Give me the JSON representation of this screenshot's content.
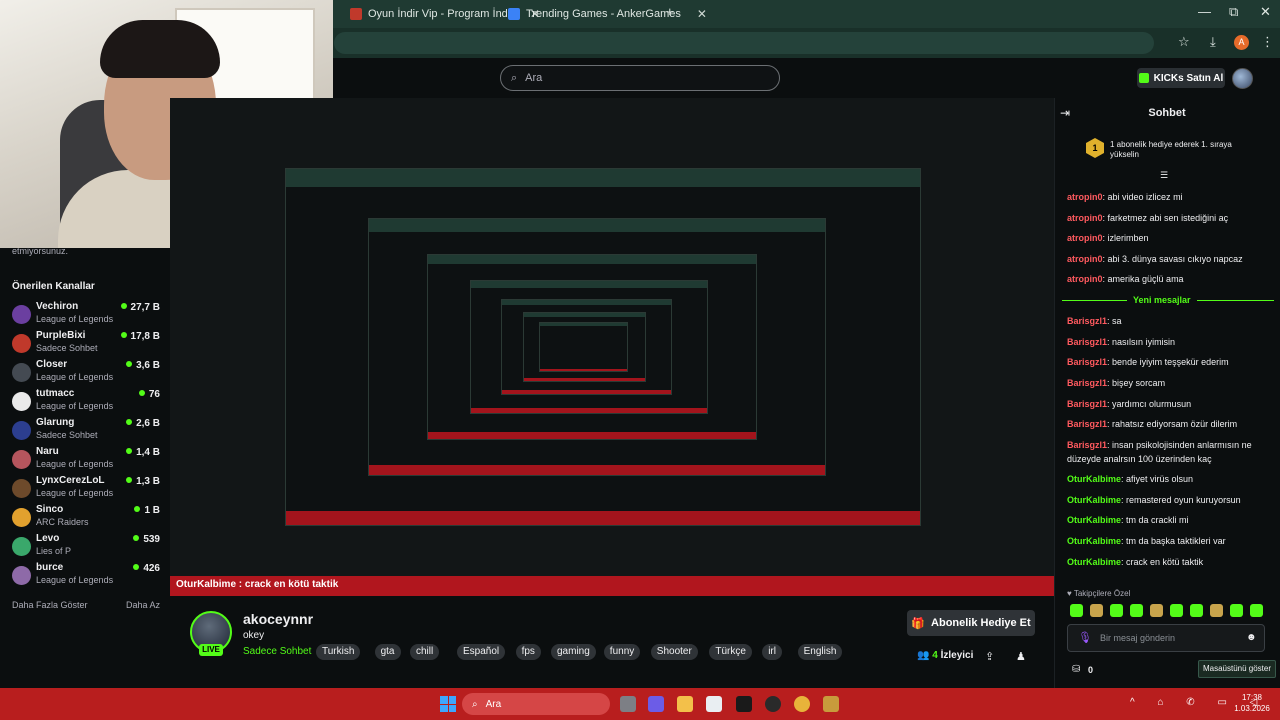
{
  "browser": {
    "tabs": [
      {
        "title": "Oyun İndir Vip - Program İndir",
        "favicon_color": "#c0392b"
      },
      {
        "title": "Trending Games - AnkerGames",
        "favicon_color": "#3b82f6"
      }
    ],
    "new_tab": "+",
    "profile_initial": "A",
    "window_controls": {
      "minimize": "—",
      "maximize": "⧉",
      "close": "✕"
    }
  },
  "header": {
    "search_placeholder": "Ara",
    "kicks_button": "KICKs Satın Al"
  },
  "sidebar": {
    "cut_text": "etmiyorsunuz.",
    "title": "Önerilen Kanallar",
    "channels": [
      {
        "name": "Vechiron",
        "game": "League of Legends",
        "viewers": "27,7 B",
        "color": "#6b3fa0"
      },
      {
        "name": "PurpleBixi",
        "game": "Sadece Sohbet",
        "viewers": "17,8 B",
        "color": "#c0392b"
      },
      {
        "name": "Closer",
        "game": "League of Legends",
        "viewers": "3,6 B",
        "color": "#444a52"
      },
      {
        "name": "tutmacc",
        "game": "League of Legends",
        "viewers": "76",
        "color": "#eaeaea"
      },
      {
        "name": "Glarung",
        "game": "Sadece Sohbet",
        "viewers": "2,6 B",
        "color": "#2c3e8f"
      },
      {
        "name": "Naru",
        "game": "League of Legends",
        "viewers": "1,4 B",
        "color": "#b5555d"
      },
      {
        "name": "LynxCerezLoL",
        "game": "League of Legends",
        "viewers": "1,3 B",
        "color": "#6d4a2b"
      },
      {
        "name": "Sinco",
        "game": "ARC Raiders",
        "viewers": "1 B",
        "color": "#e2a12e"
      },
      {
        "name": "Levo",
        "game": "Lies of P",
        "viewers": "539",
        "color": "#3aa86b"
      },
      {
        "name": "burce",
        "game": "League of Legends",
        "viewers": "426",
        "color": "#8e6aa8"
      }
    ],
    "show_more": "Daha Fazla Göster",
    "show_less": "Daha Az"
  },
  "video": {
    "overlay_user": "OturKalbime",
    "overlay_message": "crack en kötü taktik"
  },
  "streamer": {
    "name": "akoceynnr",
    "title": "okey",
    "live": "LIVE",
    "category": "Sadece Sohbet",
    "tags": [
      "Turkish",
      "gta",
      "chill",
      "Español",
      "fps",
      "gaming",
      "funny",
      "Shooter",
      "Türkçe",
      "irl",
      "English"
    ],
    "gift_button": "Abonelik Hediye Et",
    "viewers_count": "4",
    "viewers_label": "İzleyici"
  },
  "chat": {
    "title": "Sohbet",
    "pinned_rank": "1",
    "pinned_text": "1 abonelik hediye ederek 1. sıraya yükselin",
    "new_messages_label": "Yeni mesajlar",
    "messages_before": [
      {
        "user": "atropin0",
        "text": "abi video izlicez mi"
      },
      {
        "user": "atropin0",
        "text": "farketmez abi sen istediğini aç"
      },
      {
        "user": "atropin0",
        "text": "izlerimben"
      },
      {
        "user": "atropin0",
        "text": "abi 3. dünya savası cıkıyo napcaz"
      },
      {
        "user": "atropin0",
        "text": "amerika güçlü ama"
      }
    ],
    "messages_after": [
      {
        "user": "Barisgzl1",
        "text": "sa",
        "color": "red"
      },
      {
        "user": "Barisgzl1",
        "text": "nasılsın iyimisin",
        "color": "red"
      },
      {
        "user": "Barisgzl1",
        "text": "bende iyiyim teşşekür ederim",
        "color": "red"
      },
      {
        "user": "Barisgzl1",
        "text": "bişey sorcam",
        "color": "red"
      },
      {
        "user": "Barisgzl1",
        "text": "yardımcı olurmusun",
        "color": "red"
      },
      {
        "user": "Barisgzl1",
        "text": "rahatsız ediyorsam özür dilerim",
        "color": "red"
      },
      {
        "user": "Barisgzl1",
        "text": "insan psikolojisinden anlarmısın ne düzeyde analrsın 100 üzerinden kaç",
        "color": "red"
      },
      {
        "user": "OturKalbime",
        "text": "afiyet virüs olsun",
        "color": "green"
      },
      {
        "user": "OturKalbime",
        "text": "remastered oyun kuruyorsun",
        "color": "green"
      },
      {
        "user": "OturKalbime",
        "text": "tm da crackli mi",
        "color": "green"
      },
      {
        "user": "OturKalbime",
        "text": "tm da başka taktikleri var",
        "color": "green"
      },
      {
        "user": "OturKalbime",
        "text": "crack en kötü taktik",
        "color": "green"
      }
    ],
    "sub_emotes_title": "Takipçilere Özel",
    "input_placeholder": "Bir mesaj gönderin",
    "points": "0",
    "desktop_tooltip": "Masaüstünü göster"
  },
  "taskbar": {
    "search_placeholder": "Ara",
    "time": "17:38",
    "date": "1.03.2026"
  },
  "colors": {
    "accent": "#53fc18",
    "chat_user_red": "#ff5a5f",
    "taskbar": "#b81e1e",
    "tabbar": "#1f3a32"
  }
}
